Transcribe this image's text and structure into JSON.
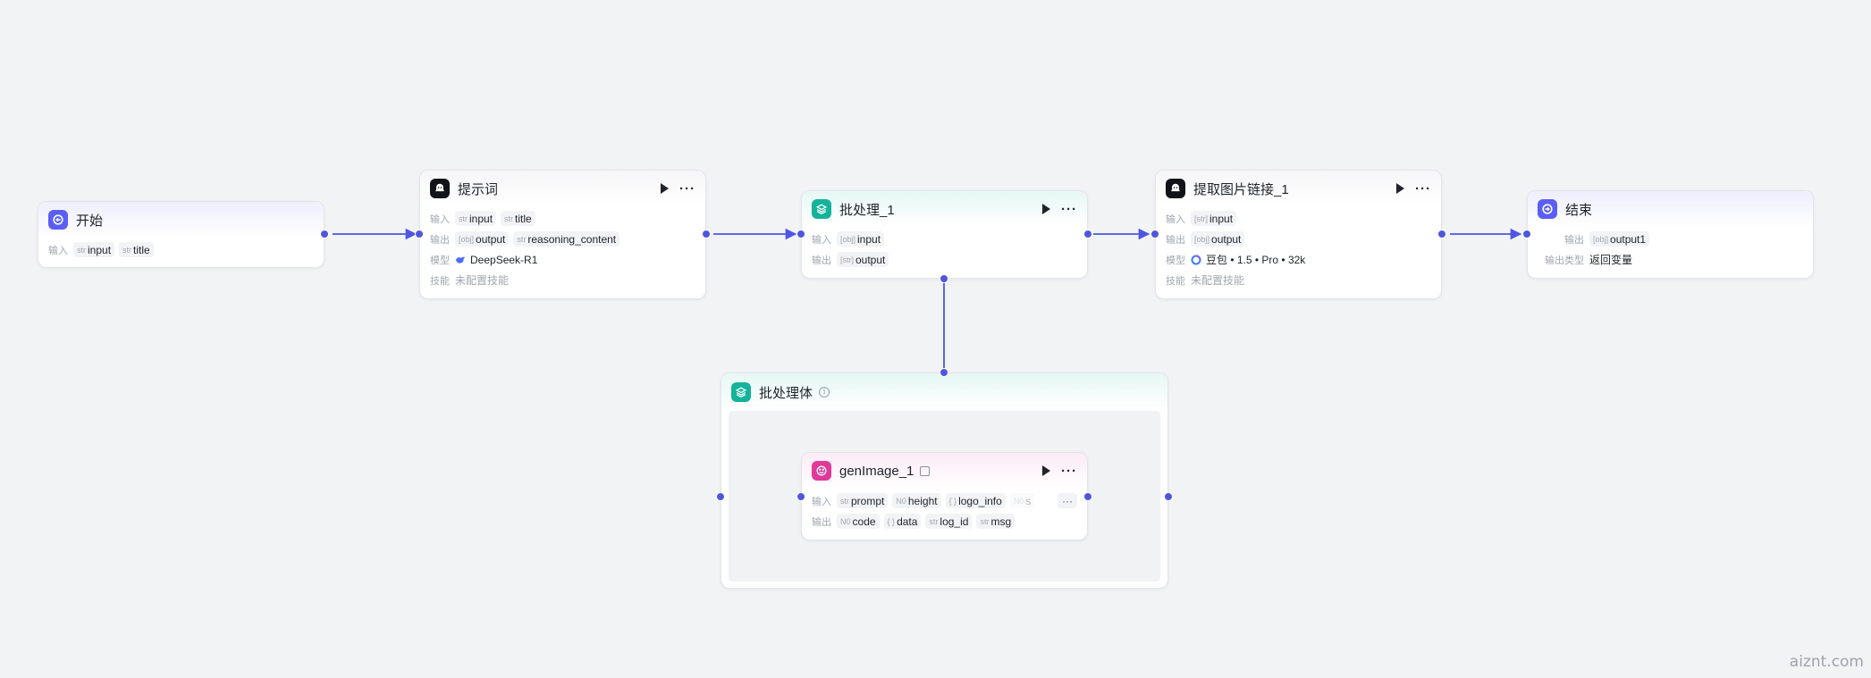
{
  "colors": {
    "accent": "#4e56e0",
    "indigo": "#5b5ef5",
    "teal": "#14b39a",
    "pink": "#e0399a"
  },
  "labels": {
    "input": "输入",
    "output": "输出",
    "model": "模型",
    "skill": "技能",
    "output_type": "输出类型",
    "no_skill": "未配置技能",
    "more": "···"
  },
  "nodes": {
    "start": {
      "title": "开始",
      "icon": "start-icon",
      "inputs": [
        {
          "type": "str",
          "name": "input"
        },
        {
          "type": "str",
          "name": "title"
        }
      ]
    },
    "prompt": {
      "title": "提示词",
      "icon": "llm-icon",
      "inputs": [
        {
          "type": "str",
          "name": "input"
        },
        {
          "type": "str",
          "name": "title"
        }
      ],
      "outputs": [
        {
          "type": "[obj]",
          "name": "output"
        },
        {
          "type": "str",
          "name": "reasoning_content"
        }
      ],
      "model": "DeepSeek-R1"
    },
    "batch": {
      "title": "批处理_1",
      "icon": "batch-icon",
      "inputs": [
        {
          "type": "[obj]",
          "name": "input"
        }
      ],
      "outputs": [
        {
          "type": "[str]",
          "name": "output"
        }
      ]
    },
    "extract": {
      "title": "提取图片链接_1",
      "icon": "llm-icon",
      "inputs": [
        {
          "type": "[str]",
          "name": "input"
        }
      ],
      "outputs": [
        {
          "type": "[obj]",
          "name": "output"
        }
      ],
      "model": "豆包 • 1.5 • Pro • 32k"
    },
    "end": {
      "title": "结束",
      "icon": "end-icon",
      "outputs": [
        {
          "type": "[obj]",
          "name": "output1"
        }
      ],
      "output_type_value": "返回变量"
    },
    "batch_body": {
      "title": "批处理体",
      "icon": "batch-icon"
    },
    "gen_image": {
      "title": "genImage_1",
      "icon": "plugin-icon",
      "inputs": [
        {
          "type": "str",
          "name": "prompt"
        },
        {
          "type": "N0",
          "name": "height"
        },
        {
          "type": "{ }",
          "name": "logo_info"
        },
        {
          "type": "N0",
          "name": "s"
        }
      ],
      "outputs": [
        {
          "type": "N0",
          "name": "code"
        },
        {
          "type": "{ }",
          "name": "data"
        },
        {
          "type": "str",
          "name": "log_id"
        },
        {
          "type": "str",
          "name": "msg"
        }
      ]
    }
  },
  "watermark": "aiznt.com"
}
